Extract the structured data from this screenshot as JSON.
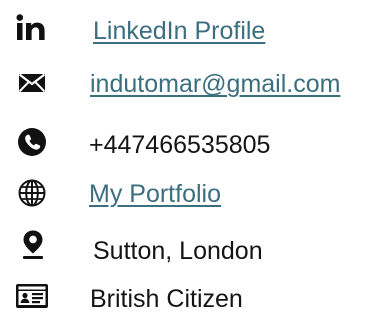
{
  "contact": {
    "linkedin": {
      "label": "LinkedIn Profile",
      "icon": "linkedin-icon"
    },
    "email": {
      "label": "indutomar@gmail.com",
      "icon": "mail-icon"
    },
    "phone": {
      "label": "+447466535805",
      "icon": "phone-icon"
    },
    "portfolio": {
      "label": "My Portfolio",
      "icon": "globe-icon"
    },
    "location": {
      "label": "Sutton, London",
      "icon": "location-pin-icon"
    },
    "citizenship": {
      "label": "British Citizen",
      "icon": "id-card-icon"
    }
  },
  "colors": {
    "link": "#3b6f7f",
    "text": "#141414",
    "icon": "#111111"
  }
}
